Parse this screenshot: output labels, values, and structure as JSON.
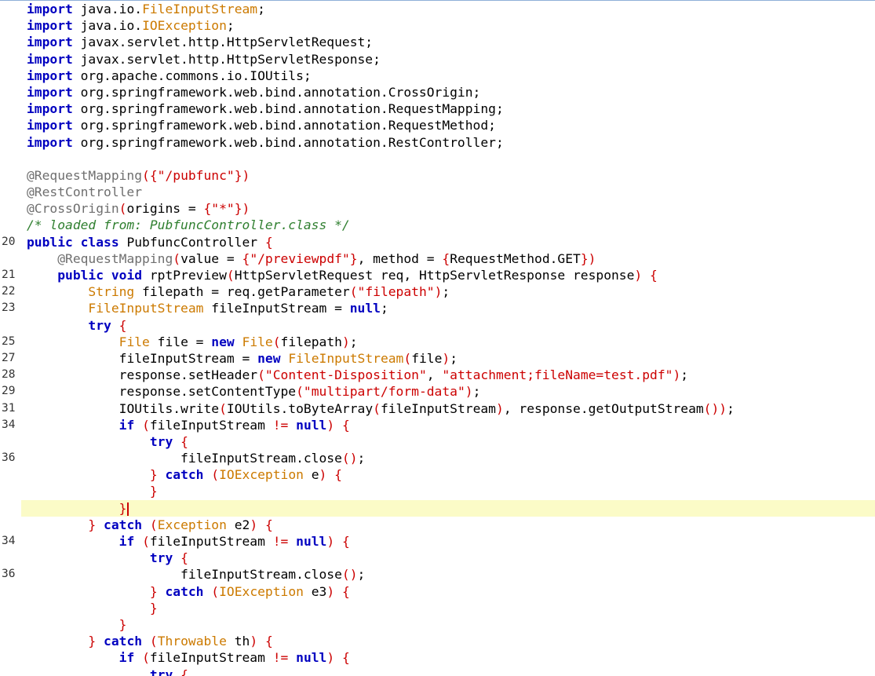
{
  "editor": {
    "lines": [
      {
        "n": "",
        "indent": 0,
        "tokens": [
          {
            "c": "kw",
            "t": "import"
          },
          {
            "c": "",
            "t": " java.io."
          },
          {
            "c": "type",
            "t": "FileInputStream"
          },
          {
            "c": "",
            "t": ";"
          }
        ]
      },
      {
        "n": "",
        "indent": 0,
        "tokens": [
          {
            "c": "kw",
            "t": "import"
          },
          {
            "c": "",
            "t": " java.io."
          },
          {
            "c": "type",
            "t": "IOException"
          },
          {
            "c": "",
            "t": ";"
          }
        ]
      },
      {
        "n": "",
        "indent": 0,
        "tokens": [
          {
            "c": "kw",
            "t": "import"
          },
          {
            "c": "",
            "t": " javax.servlet.http.HttpServletRequest;"
          }
        ]
      },
      {
        "n": "",
        "indent": 0,
        "tokens": [
          {
            "c": "kw",
            "t": "import"
          },
          {
            "c": "",
            "t": " javax.servlet.http.HttpServletResponse;"
          }
        ]
      },
      {
        "n": "",
        "indent": 0,
        "tokens": [
          {
            "c": "kw",
            "t": "import"
          },
          {
            "c": "",
            "t": " org.apache.commons.io.IOUtils;"
          }
        ]
      },
      {
        "n": "",
        "indent": 0,
        "tokens": [
          {
            "c": "kw",
            "t": "import"
          },
          {
            "c": "",
            "t": " org.springframework.web.bind.annotation.CrossOrigin;"
          }
        ]
      },
      {
        "n": "",
        "indent": 0,
        "tokens": [
          {
            "c": "kw",
            "t": "import"
          },
          {
            "c": "",
            "t": " org.springframework.web.bind.annotation.RequestMapping;"
          }
        ]
      },
      {
        "n": "",
        "indent": 0,
        "tokens": [
          {
            "c": "kw",
            "t": "import"
          },
          {
            "c": "",
            "t": " org.springframework.web.bind.annotation.RequestMethod;"
          }
        ]
      },
      {
        "n": "",
        "indent": 0,
        "tokens": [
          {
            "c": "kw",
            "t": "import"
          },
          {
            "c": "",
            "t": " org.springframework.web.bind.annotation.RestController;"
          }
        ]
      },
      {
        "n": "",
        "indent": 0,
        "tokens": []
      },
      {
        "n": "",
        "indent": 0,
        "tokens": [
          {
            "c": "ann",
            "t": "@RequestMapping"
          },
          {
            "c": "paren",
            "t": "({"
          },
          {
            "c": "str",
            "t": "\"/pubfunc\""
          },
          {
            "c": "paren",
            "t": "})"
          }
        ]
      },
      {
        "n": "",
        "indent": 0,
        "tokens": [
          {
            "c": "ann",
            "t": "@RestController"
          }
        ]
      },
      {
        "n": "",
        "indent": 0,
        "tokens": [
          {
            "c": "ann",
            "t": "@CrossOrigin"
          },
          {
            "c": "paren",
            "t": "("
          },
          {
            "c": "",
            "t": "origins = "
          },
          {
            "c": "paren",
            "t": "{"
          },
          {
            "c": "str",
            "t": "\"*\""
          },
          {
            "c": "paren",
            "t": "})"
          }
        ]
      },
      {
        "n": "",
        "indent": 0,
        "tokens": [
          {
            "c": "cmt",
            "t": "/* loaded from: PubfuncController.class */"
          }
        ]
      },
      {
        "n": "20",
        "indent": 0,
        "tokens": [
          {
            "c": "kw",
            "t": "public class"
          },
          {
            "c": "",
            "t": " PubfuncController "
          },
          {
            "c": "paren",
            "t": "{"
          }
        ]
      },
      {
        "n": "",
        "indent": 1,
        "tokens": [
          {
            "c": "ann",
            "t": "@RequestMapping"
          },
          {
            "c": "paren",
            "t": "("
          },
          {
            "c": "",
            "t": "value = "
          },
          {
            "c": "paren",
            "t": "{"
          },
          {
            "c": "str",
            "t": "\"/previewpdf\""
          },
          {
            "c": "paren",
            "t": "}"
          },
          {
            "c": "",
            "t": ", method = "
          },
          {
            "c": "paren",
            "t": "{"
          },
          {
            "c": "",
            "t": "RequestMethod.GET"
          },
          {
            "c": "paren",
            "t": "})"
          }
        ]
      },
      {
        "n": "21",
        "indent": 1,
        "tokens": [
          {
            "c": "kw",
            "t": "public void"
          },
          {
            "c": "",
            "t": " rptPreview"
          },
          {
            "c": "paren",
            "t": "("
          },
          {
            "c": "",
            "t": "HttpServletRequest req, HttpServletResponse response"
          },
          {
            "c": "paren",
            "t": ")"
          },
          {
            "c": "",
            "t": " "
          },
          {
            "c": "paren",
            "t": "{"
          }
        ]
      },
      {
        "n": "22",
        "indent": 2,
        "tokens": [
          {
            "c": "type",
            "t": "String"
          },
          {
            "c": "",
            "t": " filepath = req.getParameter"
          },
          {
            "c": "paren",
            "t": "("
          },
          {
            "c": "str",
            "t": "\"filepath\""
          },
          {
            "c": "paren",
            "t": ")"
          },
          {
            "c": "",
            "t": ";"
          }
        ]
      },
      {
        "n": "23",
        "indent": 2,
        "tokens": [
          {
            "c": "type",
            "t": "FileInputStream"
          },
          {
            "c": "",
            "t": " fileInputStream = "
          },
          {
            "c": "kw",
            "t": "null"
          },
          {
            "c": "",
            "t": ";"
          }
        ]
      },
      {
        "n": "",
        "indent": 2,
        "tokens": [
          {
            "c": "kw",
            "t": "try"
          },
          {
            "c": "",
            "t": " "
          },
          {
            "c": "paren",
            "t": "{"
          }
        ]
      },
      {
        "n": "25",
        "indent": 3,
        "tokens": [
          {
            "c": "type",
            "t": "File"
          },
          {
            "c": "",
            "t": " file = "
          },
          {
            "c": "kw",
            "t": "new"
          },
          {
            "c": "",
            "t": " "
          },
          {
            "c": "type",
            "t": "File"
          },
          {
            "c": "paren",
            "t": "("
          },
          {
            "c": "",
            "t": "filepath"
          },
          {
            "c": "paren",
            "t": ")"
          },
          {
            "c": "",
            "t": ";"
          }
        ]
      },
      {
        "n": "27",
        "indent": 3,
        "tokens": [
          {
            "c": "",
            "t": "fileInputStream = "
          },
          {
            "c": "kw",
            "t": "new"
          },
          {
            "c": "",
            "t": " "
          },
          {
            "c": "type",
            "t": "FileInputStream"
          },
          {
            "c": "paren",
            "t": "("
          },
          {
            "c": "",
            "t": "file"
          },
          {
            "c": "paren",
            "t": ")"
          },
          {
            "c": "",
            "t": ";"
          }
        ]
      },
      {
        "n": "28",
        "indent": 3,
        "tokens": [
          {
            "c": "",
            "t": "response.setHeader"
          },
          {
            "c": "paren",
            "t": "("
          },
          {
            "c": "str",
            "t": "\"Content-Disposition\""
          },
          {
            "c": "",
            "t": ", "
          },
          {
            "c": "str",
            "t": "\"attachment;fileName=test.pdf\""
          },
          {
            "c": "paren",
            "t": ")"
          },
          {
            "c": "",
            "t": ";"
          }
        ]
      },
      {
        "n": "29",
        "indent": 3,
        "tokens": [
          {
            "c": "",
            "t": "response.setContentType"
          },
          {
            "c": "paren",
            "t": "("
          },
          {
            "c": "str",
            "t": "\"multipart/form-data\""
          },
          {
            "c": "paren",
            "t": ")"
          },
          {
            "c": "",
            "t": ";"
          }
        ]
      },
      {
        "n": "31",
        "indent": 3,
        "tokens": [
          {
            "c": "",
            "t": "IOUtils.write"
          },
          {
            "c": "paren",
            "t": "("
          },
          {
            "c": "",
            "t": "IOUtils.toByteArray"
          },
          {
            "c": "paren",
            "t": "("
          },
          {
            "c": "",
            "t": "fileInputStream"
          },
          {
            "c": "paren",
            "t": ")"
          },
          {
            "c": "",
            "t": ", response.getOutputStream"
          },
          {
            "c": "paren",
            "t": "())"
          },
          {
            "c": "",
            "t": ";"
          }
        ]
      },
      {
        "n": "34",
        "indent": 3,
        "tokens": [
          {
            "c": "kw",
            "t": "if"
          },
          {
            "c": "",
            "t": " "
          },
          {
            "c": "paren",
            "t": "("
          },
          {
            "c": "",
            "t": "fileInputStream "
          },
          {
            "c": "paren",
            "t": "!="
          },
          {
            "c": "",
            "t": " "
          },
          {
            "c": "kw",
            "t": "null"
          },
          {
            "c": "paren",
            "t": ")"
          },
          {
            "c": "",
            "t": " "
          },
          {
            "c": "paren",
            "t": "{"
          }
        ]
      },
      {
        "n": "",
        "indent": 4,
        "tokens": [
          {
            "c": "kw",
            "t": "try"
          },
          {
            "c": "",
            "t": " "
          },
          {
            "c": "paren",
            "t": "{"
          }
        ]
      },
      {
        "n": "36",
        "indent": 5,
        "tokens": [
          {
            "c": "",
            "t": "fileInputStream.close"
          },
          {
            "c": "paren",
            "t": "()"
          },
          {
            "c": "",
            "t": ";"
          }
        ]
      },
      {
        "n": "",
        "indent": 4,
        "tokens": [
          {
            "c": "paren",
            "t": "}"
          },
          {
            "c": "",
            "t": " "
          },
          {
            "c": "kw",
            "t": "catch"
          },
          {
            "c": "",
            "t": " "
          },
          {
            "c": "paren",
            "t": "("
          },
          {
            "c": "type",
            "t": "IOException"
          },
          {
            "c": "",
            "t": " e"
          },
          {
            "c": "paren",
            "t": ")"
          },
          {
            "c": "",
            "t": " "
          },
          {
            "c": "paren",
            "t": "{"
          }
        ]
      },
      {
        "n": "",
        "indent": 4,
        "tokens": [
          {
            "c": "paren",
            "t": "}"
          }
        ]
      },
      {
        "n": "",
        "indent": 3,
        "current": true,
        "tokens": [
          {
            "c": "paren",
            "t": "}"
          }
        ]
      },
      {
        "n": "",
        "indent": 2,
        "tokens": [
          {
            "c": "paren",
            "t": "}"
          },
          {
            "c": "",
            "t": " "
          },
          {
            "c": "kw",
            "t": "catch"
          },
          {
            "c": "",
            "t": " "
          },
          {
            "c": "paren",
            "t": "("
          },
          {
            "c": "type",
            "t": "Exception"
          },
          {
            "c": "",
            "t": " e2"
          },
          {
            "c": "paren",
            "t": ")"
          },
          {
            "c": "",
            "t": " "
          },
          {
            "c": "paren",
            "t": "{"
          }
        ]
      },
      {
        "n": "34",
        "indent": 3,
        "tokens": [
          {
            "c": "kw",
            "t": "if"
          },
          {
            "c": "",
            "t": " "
          },
          {
            "c": "paren",
            "t": "("
          },
          {
            "c": "",
            "t": "fileInputStream "
          },
          {
            "c": "paren",
            "t": "!="
          },
          {
            "c": "",
            "t": " "
          },
          {
            "c": "kw",
            "t": "null"
          },
          {
            "c": "paren",
            "t": ")"
          },
          {
            "c": "",
            "t": " "
          },
          {
            "c": "paren",
            "t": "{"
          }
        ]
      },
      {
        "n": "",
        "indent": 4,
        "tokens": [
          {
            "c": "kw",
            "t": "try"
          },
          {
            "c": "",
            "t": " "
          },
          {
            "c": "paren",
            "t": "{"
          }
        ]
      },
      {
        "n": "36",
        "indent": 5,
        "tokens": [
          {
            "c": "",
            "t": "fileInputStream.close"
          },
          {
            "c": "paren",
            "t": "()"
          },
          {
            "c": "",
            "t": ";"
          }
        ]
      },
      {
        "n": "",
        "indent": 4,
        "tokens": [
          {
            "c": "paren",
            "t": "}"
          },
          {
            "c": "",
            "t": " "
          },
          {
            "c": "kw",
            "t": "catch"
          },
          {
            "c": "",
            "t": " "
          },
          {
            "c": "paren",
            "t": "("
          },
          {
            "c": "type",
            "t": "IOException"
          },
          {
            "c": "",
            "t": " e3"
          },
          {
            "c": "paren",
            "t": ")"
          },
          {
            "c": "",
            "t": " "
          },
          {
            "c": "paren",
            "t": "{"
          }
        ]
      },
      {
        "n": "",
        "indent": 4,
        "tokens": [
          {
            "c": "paren",
            "t": "}"
          }
        ]
      },
      {
        "n": "",
        "indent": 3,
        "tokens": [
          {
            "c": "paren",
            "t": "}"
          }
        ]
      },
      {
        "n": "",
        "indent": 2,
        "tokens": [
          {
            "c": "paren",
            "t": "}"
          },
          {
            "c": "",
            "t": " "
          },
          {
            "c": "kw",
            "t": "catch"
          },
          {
            "c": "",
            "t": " "
          },
          {
            "c": "paren",
            "t": "("
          },
          {
            "c": "type",
            "t": "Throwable"
          },
          {
            "c": "",
            "t": " th"
          },
          {
            "c": "paren",
            "t": ")"
          },
          {
            "c": "",
            "t": " "
          },
          {
            "c": "paren",
            "t": "{"
          }
        ]
      },
      {
        "n": "",
        "indent": 3,
        "tokens": [
          {
            "c": "kw",
            "t": "if"
          },
          {
            "c": "",
            "t": " "
          },
          {
            "c": "paren",
            "t": "("
          },
          {
            "c": "",
            "t": "fileInputStream "
          },
          {
            "c": "paren",
            "t": "!="
          },
          {
            "c": "",
            "t": " "
          },
          {
            "c": "kw",
            "t": "null"
          },
          {
            "c": "paren",
            "t": ")"
          },
          {
            "c": "",
            "t": " "
          },
          {
            "c": "paren",
            "t": "{"
          }
        ]
      },
      {
        "n": "",
        "indent": 4,
        "tokens": [
          {
            "c": "kw",
            "t": "try"
          },
          {
            "c": "",
            "t": " "
          },
          {
            "c": "paren",
            "t": "{"
          }
        ]
      }
    ],
    "colors": {
      "keyword": "#0000c0",
      "string": "#cc0000",
      "type": "#cc7a00",
      "annotation": "#6f6f6f",
      "comment": "#2f7f2f",
      "current_line": "#fbfbc7",
      "caret": "#cc0000"
    }
  }
}
